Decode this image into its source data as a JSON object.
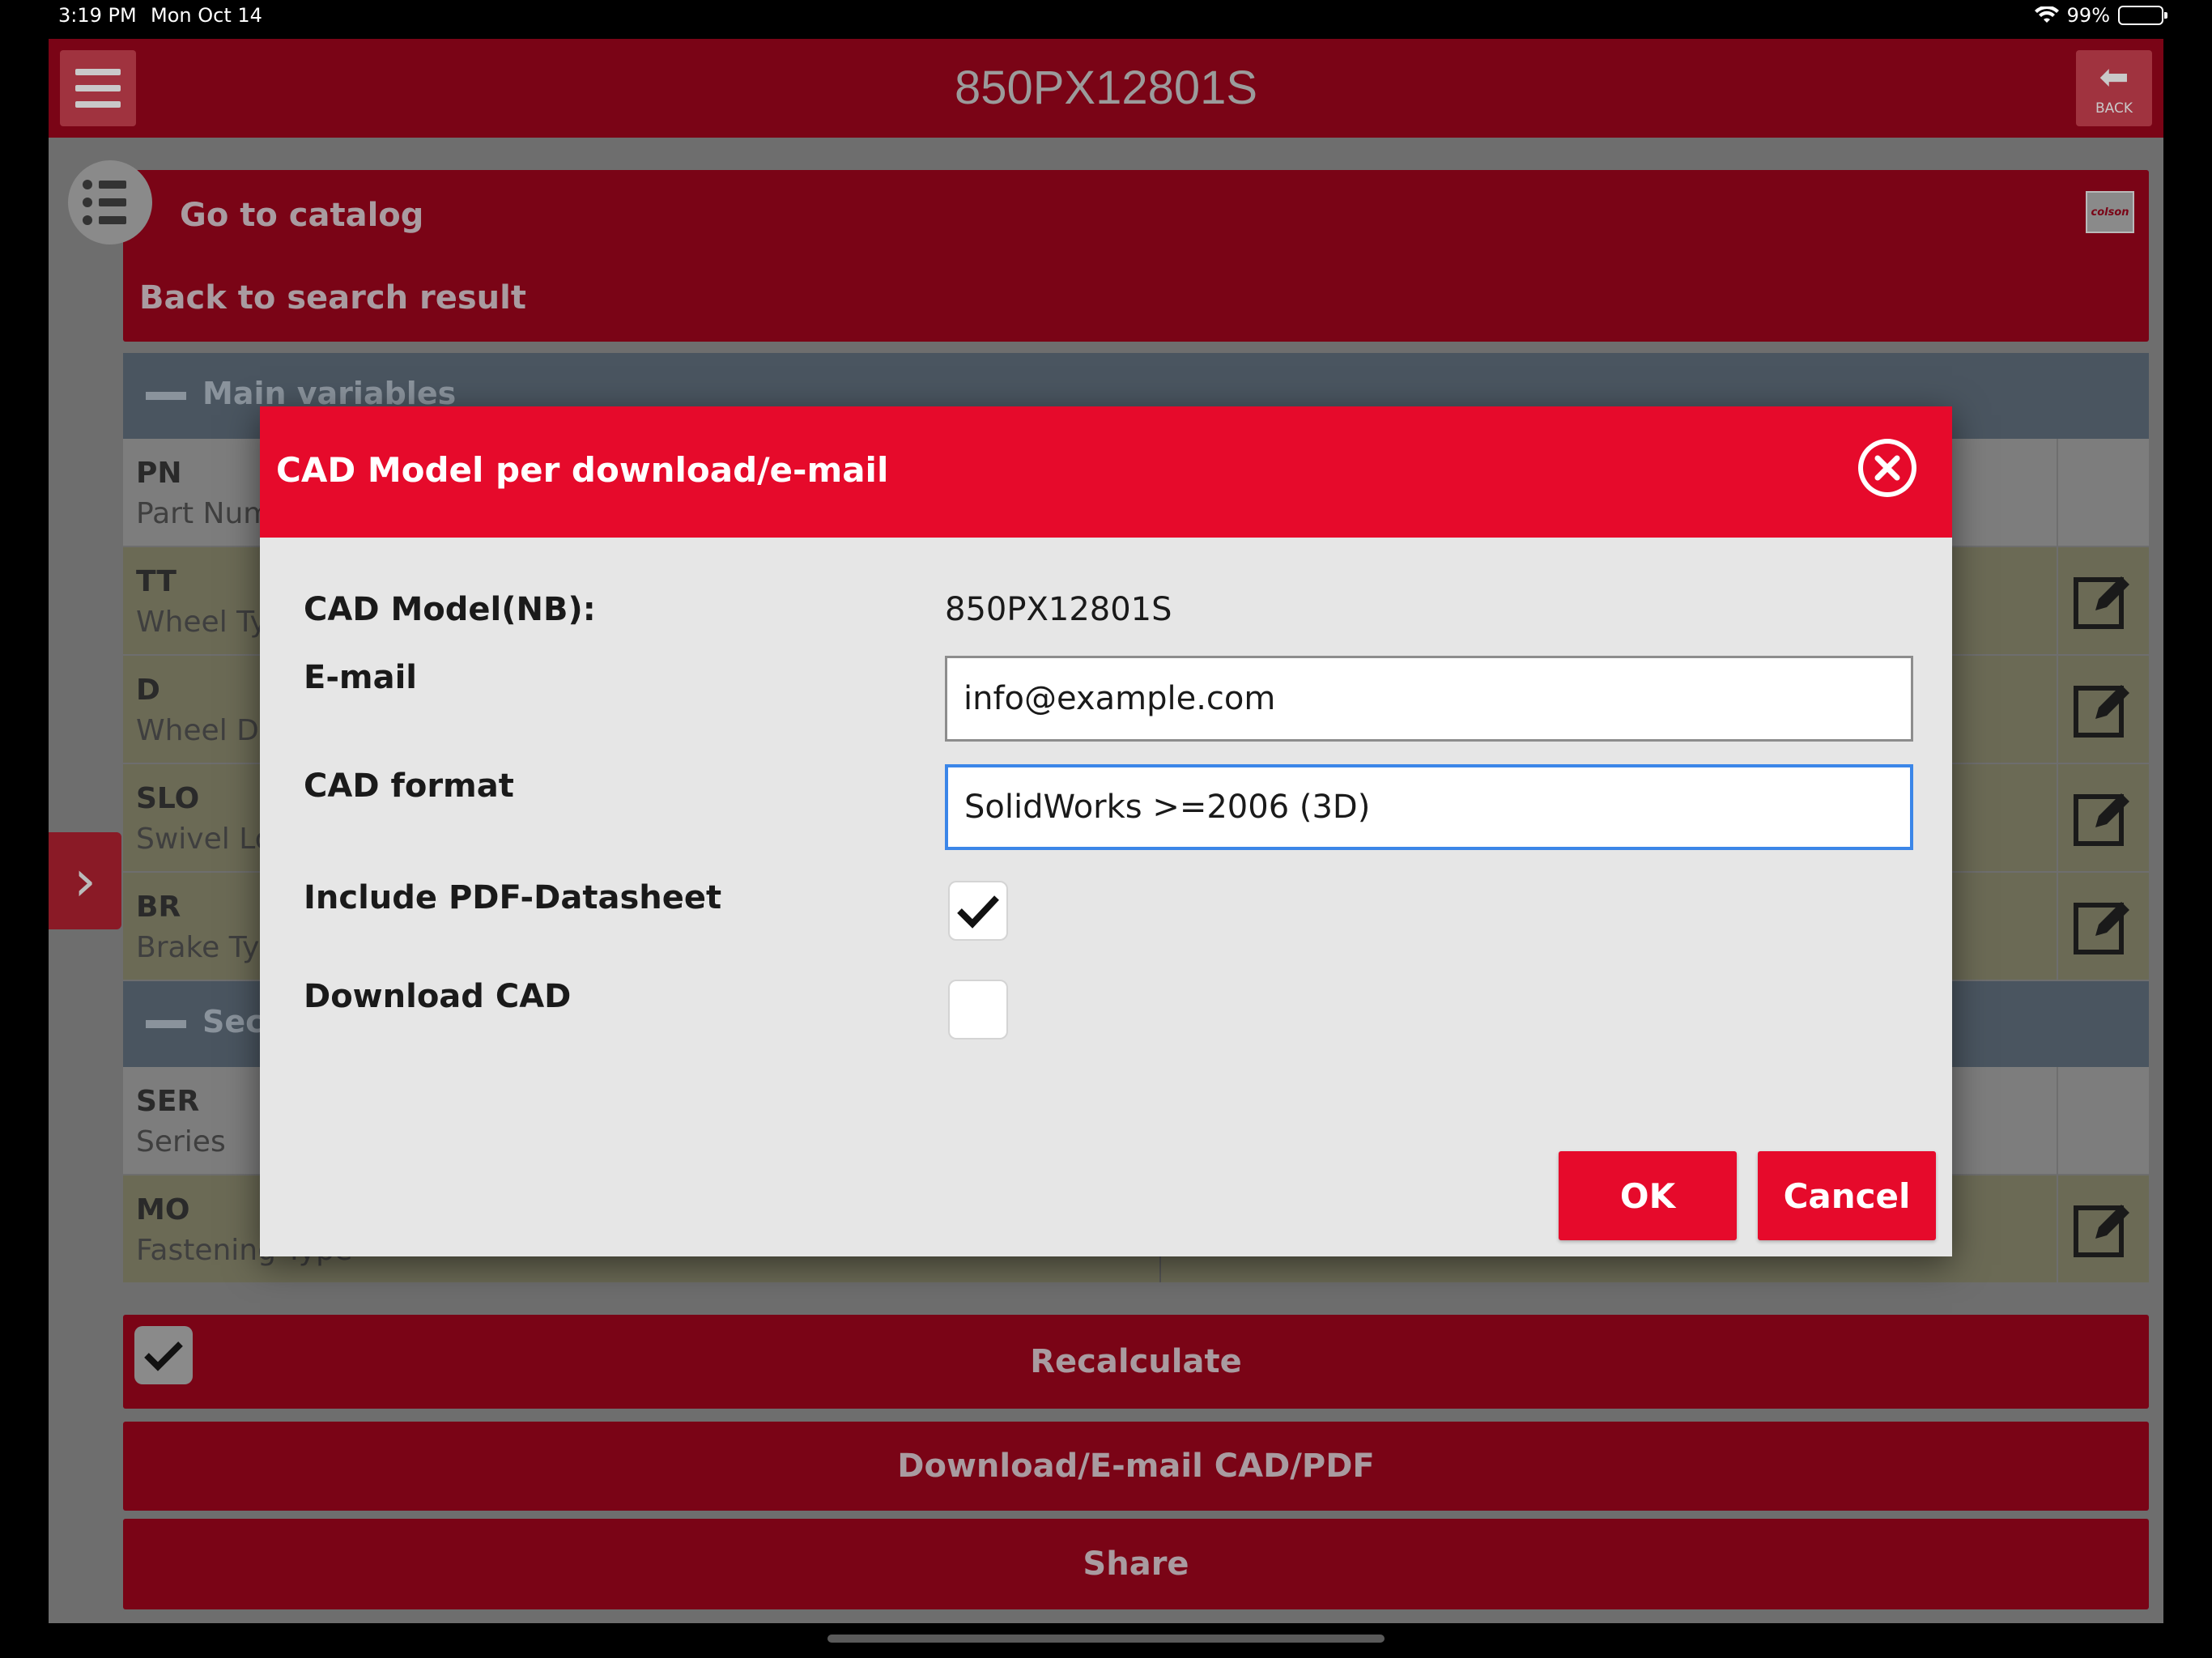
{
  "status_bar": {
    "time": "3:19 PM",
    "date": "Mon Oct 14",
    "battery": "99%"
  },
  "app": {
    "title": "850PX12801S",
    "back_label": "BACK",
    "catalog_logo_text": "colson",
    "go_to_catalog": "Go to catalog",
    "back_to_search": "Back to search result"
  },
  "sections": {
    "main": "Main variables",
    "secondary": "Seco"
  },
  "rows": [
    {
      "code": "PN",
      "desc": "Part Num"
    },
    {
      "code": "TT",
      "desc": "Wheel Ty"
    },
    {
      "code": "D",
      "desc": "Wheel Di"
    },
    {
      "code": "SLO",
      "desc": "Swivel Lo"
    },
    {
      "code": "BR",
      "desc": "Brake Typ"
    },
    {
      "code": "SER",
      "desc": "Series"
    },
    {
      "code": "MO",
      "desc": "Fastening Type"
    }
  ],
  "actions": {
    "recalculate": "Recalculate",
    "download_email": "Download/E-mail CAD/PDF",
    "share": "Share"
  },
  "dialog": {
    "title": "CAD Model per download/e-mail",
    "cad_model_label": "CAD Model(NB):",
    "cad_model_value": "850PX12801S",
    "email_label": "E-mail",
    "email_value": "info@example.com",
    "cad_format_label": "CAD format",
    "cad_format_value": "SolidWorks >=2006 (3D)",
    "include_pdf_label": "Include PDF-Datasheet",
    "include_pdf_checked": true,
    "download_cad_label": "Download CAD",
    "download_cad_checked": false,
    "ok_label": "OK",
    "cancel_label": "Cancel"
  },
  "colors": {
    "brand_dark": "#7a0416",
    "dialog_red": "#e60a2b",
    "focus_blue": "#3b86e8"
  }
}
